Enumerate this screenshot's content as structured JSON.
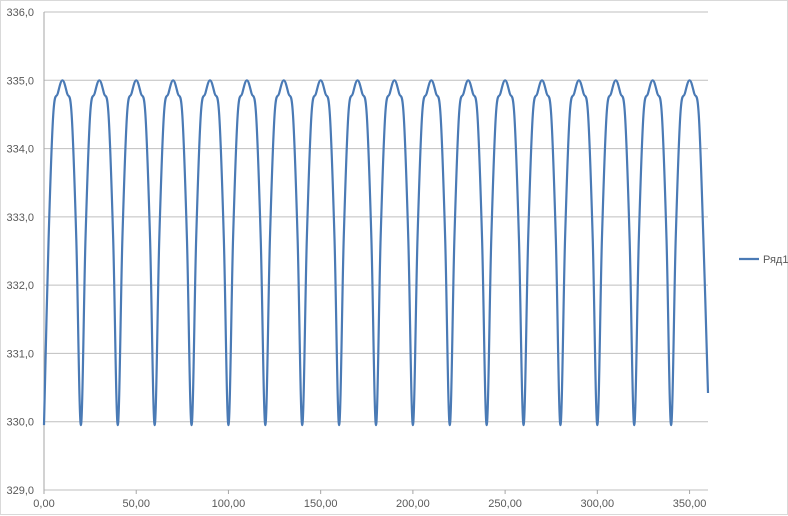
{
  "chart_data": {
    "type": "line",
    "title": "",
    "xlabel": "",
    "ylabel": "",
    "xlim": [
      0,
      360
    ],
    "ylim": [
      329.0,
      336.0
    ],
    "x_ticks": [
      0,
      50,
      100,
      150,
      200,
      250,
      300,
      350
    ],
    "x_tick_labels": [
      "0,00",
      "50,00",
      "100,00",
      "150,00",
      "200,00",
      "250,00",
      "300,00",
      "350,00"
    ],
    "y_ticks": [
      329,
      330,
      331,
      332,
      333,
      334,
      335,
      336
    ],
    "y_tick_labels": [
      "329,0",
      "330,0",
      "331,0",
      "332,0",
      "333,0",
      "334,0",
      "335,0",
      "336,0"
    ],
    "grid": "horizontal",
    "legend_position": "right",
    "series": [
      {
        "name": "Ряд1",
        "color": "#4a7ab5",
        "x": [
          0,
          2.5,
          5,
          7.5,
          10,
          12.5,
          15,
          17.5,
          20,
          22.5,
          25,
          27.5,
          30,
          32.5,
          35,
          37.5,
          40,
          42.5,
          45,
          47.5,
          50,
          52.5,
          55,
          57.5,
          60,
          62.5,
          65,
          67.5,
          70,
          72.5,
          75,
          77.5,
          80,
          82.5,
          85,
          87.5,
          90,
          92.5,
          95,
          97.5,
          100,
          102.5,
          105,
          107.5,
          110,
          112.5,
          115,
          117.5,
          120,
          122.5,
          125,
          127.5,
          130,
          132.5,
          135,
          137.5,
          140,
          142.5,
          145,
          147.5,
          150,
          152.5,
          155,
          157.5,
          160,
          162.5,
          165,
          167.5,
          170,
          172.5,
          175,
          177.5,
          180,
          182.5,
          185,
          187.5,
          190,
          192.5,
          195,
          197.5,
          200,
          202.5,
          205,
          207.5,
          210,
          212.5,
          215,
          217.5,
          220,
          222.5,
          225,
          227.5,
          230,
          232.5,
          235,
          237.5,
          240,
          242.5,
          245,
          247.5,
          250,
          252.5,
          255,
          257.5,
          260,
          262.5,
          265,
          267.5,
          270,
          272.5,
          275,
          277.5,
          280,
          282.5,
          285,
          287.5,
          290,
          292.5,
          295,
          297.5,
          300,
          302.5,
          305,
          307.5,
          310,
          312.5,
          315,
          317.5,
          320,
          322.5,
          325,
          327.5,
          330,
          332.5,
          335,
          337.5,
          340,
          342.5,
          345,
          347.5,
          350,
          352.5,
          355,
          357.5,
          360
        ],
        "y": [
          329.95,
          332.68,
          334.49,
          334.81,
          335.0,
          334.81,
          334.49,
          332.68,
          329.95,
          332.68,
          334.49,
          334.81,
          335.0,
          334.81,
          334.49,
          332.68,
          329.95,
          332.68,
          334.49,
          334.81,
          335.0,
          334.81,
          334.49,
          332.68,
          329.95,
          332.68,
          334.49,
          334.81,
          335.0,
          334.81,
          334.49,
          332.68,
          329.95,
          332.68,
          334.49,
          334.81,
          335.0,
          334.81,
          334.49,
          332.68,
          329.95,
          332.68,
          334.49,
          334.81,
          335.0,
          334.81,
          334.49,
          332.68,
          329.95,
          332.68,
          334.49,
          334.81,
          335.0,
          334.81,
          334.49,
          332.68,
          329.95,
          332.68,
          334.49,
          334.81,
          335.0,
          334.81,
          334.49,
          332.68,
          329.95,
          332.68,
          334.49,
          334.81,
          335.0,
          334.81,
          334.49,
          332.68,
          329.95,
          332.68,
          334.49,
          334.81,
          335.0,
          334.81,
          334.49,
          332.68,
          329.95,
          332.68,
          334.49,
          334.81,
          335.0,
          334.81,
          334.49,
          332.68,
          329.95,
          332.68,
          334.49,
          334.81,
          335.0,
          334.81,
          334.49,
          332.68,
          329.95,
          332.68,
          334.49,
          334.81,
          335.0,
          334.81,
          334.49,
          332.68,
          329.95,
          332.68,
          334.49,
          334.81,
          335.0,
          334.81,
          334.49,
          332.68,
          329.95,
          332.68,
          334.49,
          334.81,
          335.0,
          334.81,
          334.49,
          332.68,
          329.95,
          332.68,
          334.49,
          334.81,
          335.0,
          334.81,
          334.49,
          332.68,
          329.95,
          332.68,
          334.49,
          334.81,
          335.0,
          334.81,
          334.49,
          332.68,
          329.95,
          332.68,
          334.49,
          334.81,
          335.0,
          334.81,
          334.49,
          332.68,
          330.42
        ]
      }
    ]
  }
}
